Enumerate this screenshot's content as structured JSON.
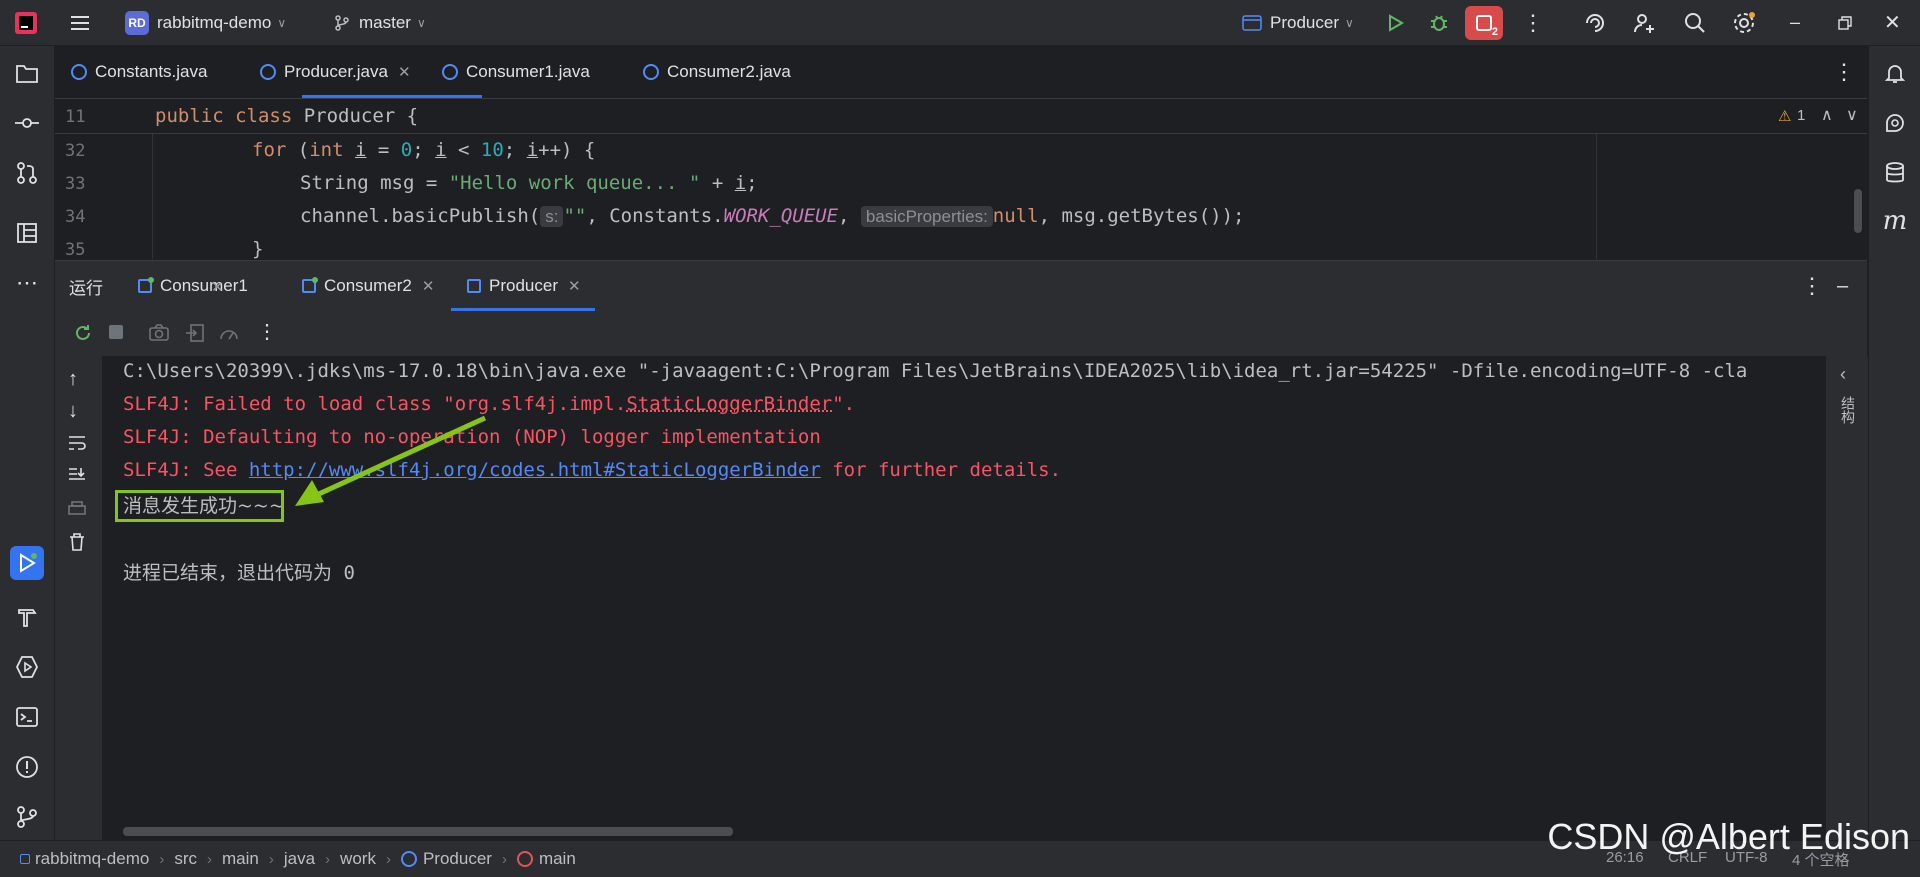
{
  "window": {
    "project_badge": "RD",
    "project_name": "rabbitmq-demo",
    "branch": "master",
    "run_config": "Producer",
    "stop_count": "2"
  },
  "editor_tabs": [
    {
      "label": "Constants.java"
    },
    {
      "label": "Producer.java",
      "active": true
    },
    {
      "label": "Consumer1.java"
    },
    {
      "label": "Consumer2.java"
    }
  ],
  "editor": {
    "sticky_line_number": "11",
    "sticky_code": "public class Producer {",
    "warning_count": "1",
    "lines": [
      {
        "number": "32",
        "kw": "for",
        "rest_open": " (",
        "int_kw": "int",
        "var": "i",
        "eq": " = ",
        "zero": "0",
        "semi1": "; ",
        "var2": "i",
        "lt": " < ",
        "ten": "10",
        "semi2": "; ",
        "var3": "i",
        "tail": "++) {"
      },
      {
        "number": "33",
        "type": "String msg = ",
        "string": "\"Hello work queue... \"",
        "tail": " + ",
        "var": "i",
        "end": ";"
      },
      {
        "number": "34",
        "prefix": "channel.basicPublish(",
        "hint1": "s:",
        "empty_str": "\"\"",
        "comma1": ", Constants.",
        "const": "WORK_QUEUE",
        "comma2": ", ",
        "hint2": "basicProperties:",
        "null_kw": "null",
        "tail": ", msg.getBytes());"
      },
      {
        "number": "35",
        "brace": "}"
      }
    ]
  },
  "run_panel": {
    "label": "运行",
    "tabs": [
      {
        "label": "Consumer1"
      },
      {
        "label": "Consumer2"
      },
      {
        "label": "Producer",
        "active": true
      }
    ]
  },
  "console": {
    "line1": "C:\\Users\\20399\\.jdks\\ms-17.0.18\\bin\\java.exe \"-javaagent:C:\\Program Files\\JetBrains\\IDEA2025\\lib\\idea_rt.jar=54225\" -Dfile.encoding=UTF-8 -cla",
    "line2_a": "SLF4J: Failed to load class \"org.slf4j.impl.",
    "line2_b": "StaticLoggerBinder",
    "line2_c": "\".",
    "line3": "SLF4J: Defaulting to no-operation (NOP) logger implementation",
    "line4_a": "SLF4J: See ",
    "line4_link": "http://www.slf4j.org/codes.html#StaticLoggerBinder",
    "line4_c": " for further details.",
    "line5": "消息发生成功~~~",
    "line6": "进程已结束，退出代码为 0",
    "right_label": "结构"
  },
  "status_bar": {
    "crumbs": [
      "rabbitmq-demo",
      "src",
      "main",
      "java",
      "work",
      "Producer",
      "main"
    ],
    "position": "26:16",
    "line_sep": "CRLF",
    "encoding": "UTF-8",
    "indent": "4 个空格"
  },
  "watermark": "CSDN @Albert Edison",
  "colors": {
    "accent": "#3574f0",
    "error_text": "#f75464",
    "highlight": "#86c516"
  }
}
